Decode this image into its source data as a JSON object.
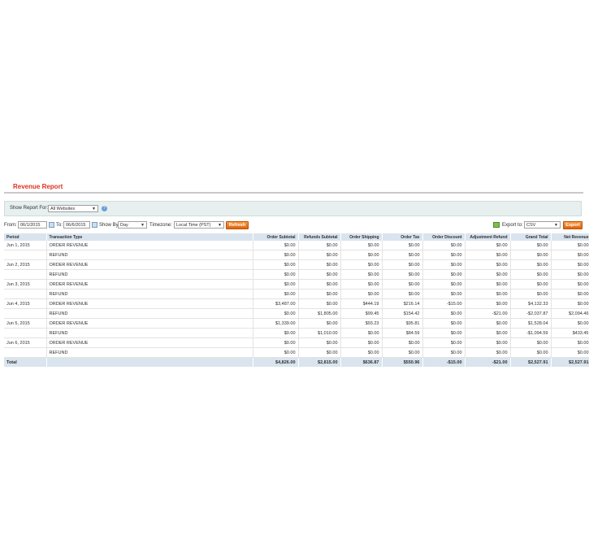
{
  "page": {
    "title": "Revenue Report"
  },
  "store_switcher": {
    "label": "Show Report For:",
    "selected": "All Websites",
    "help_icon": "question-circle-icon"
  },
  "filters": {
    "from_label": "From:",
    "from_value": "06/1/2015",
    "to_label": "To:",
    "to_value": "06/6/2015",
    "show_by_label": "Show By:",
    "show_by_value": "Day",
    "timezone_label": "Timezone:",
    "timezone_value": "Local Time (PST)",
    "refresh_label": "Refresh",
    "export_label": "Export to:",
    "export_format": "CSV",
    "export_button": "Export"
  },
  "table": {
    "headers": [
      "Period",
      "Transaction Type",
      "Order Subtotal",
      "Refunds Subtotal",
      "Order Shipping",
      "Order Tax",
      "Order Discount",
      "Adjustment Refund",
      "Grand Total",
      "Net Revenue"
    ],
    "rows": [
      [
        "Jun 1, 2015",
        "ORDER REVENUE",
        "$0.00",
        "$0.00",
        "$0.00",
        "$0.00",
        "$0.00",
        "$0.00",
        "$0.00",
        "$0.00"
      ],
      [
        "",
        "REFUND",
        "$0.00",
        "$0.00",
        "$0.00",
        "$0.00",
        "$0.00",
        "$0.00",
        "$0.00",
        "$0.00"
      ],
      [
        "Jun 2, 2015",
        "ORDER REVENUE",
        "$0.00",
        "$0.00",
        "$0.00",
        "$0.00",
        "$0.00",
        "$0.00",
        "$0.00",
        "$0.00"
      ],
      [
        "",
        "REFUND",
        "$0.00",
        "$0.00",
        "$0.00",
        "$0.00",
        "$0.00",
        "$0.00",
        "$0.00",
        "$0.00"
      ],
      [
        "Jun 3, 2015",
        "ORDER REVENUE",
        "$0.00",
        "$0.00",
        "$0.00",
        "$0.00",
        "$0.00",
        "$0.00",
        "$0.00",
        "$0.00"
      ],
      [
        "",
        "REFUND",
        "$0.00",
        "$0.00",
        "$0.00",
        "$0.00",
        "$0.00",
        "$0.00",
        "$0.00",
        "$0.00"
      ],
      [
        "Jun 4, 2015",
        "ORDER REVENUE",
        "$3,487.00",
        "$0.00",
        "$444.19",
        "$216.14",
        "-$15.00",
        "$0.00",
        "$4,132.33",
        "$0.00"
      ],
      [
        "",
        "REFUND",
        "$0.00",
        "$1,805.00",
        "$99.45",
        "$154.42",
        "$0.00",
        "-$21.00",
        "-$2,037.87",
        "$2,094.46"
      ],
      [
        "Jun 5, 2015",
        "ORDER REVENUE",
        "$1,339.00",
        "$0.00",
        "$93.23",
        "$95.81",
        "$0.00",
        "$0.00",
        "$1,528.04",
        "$0.00"
      ],
      [
        "",
        "REFUND",
        "$0.00",
        "$1,010.00",
        "$0.00",
        "$84.59",
        "$0.00",
        "$0.00",
        "-$1,094.59",
        "$433.45"
      ],
      [
        "Jun 6, 2015",
        "ORDER REVENUE",
        "$0.00",
        "$0.00",
        "$0.00",
        "$0.00",
        "$0.00",
        "$0.00",
        "$0.00",
        "$0.00"
      ],
      [
        "",
        "REFUND",
        "$0.00",
        "$0.00",
        "$0.00",
        "$0.00",
        "$0.00",
        "$0.00",
        "$0.00",
        "$0.00"
      ]
    ],
    "total": [
      "Total",
      "",
      "$4,826.00",
      "$2,815.00",
      "$636.87",
      "$550.96",
      "-$15.00",
      "-$21.00",
      "$2,527.91",
      "$2,527.91"
    ]
  },
  "colors": {
    "title": "#e0301e",
    "header_bg": "#d9e4ee",
    "button": "#e2620e"
  }
}
